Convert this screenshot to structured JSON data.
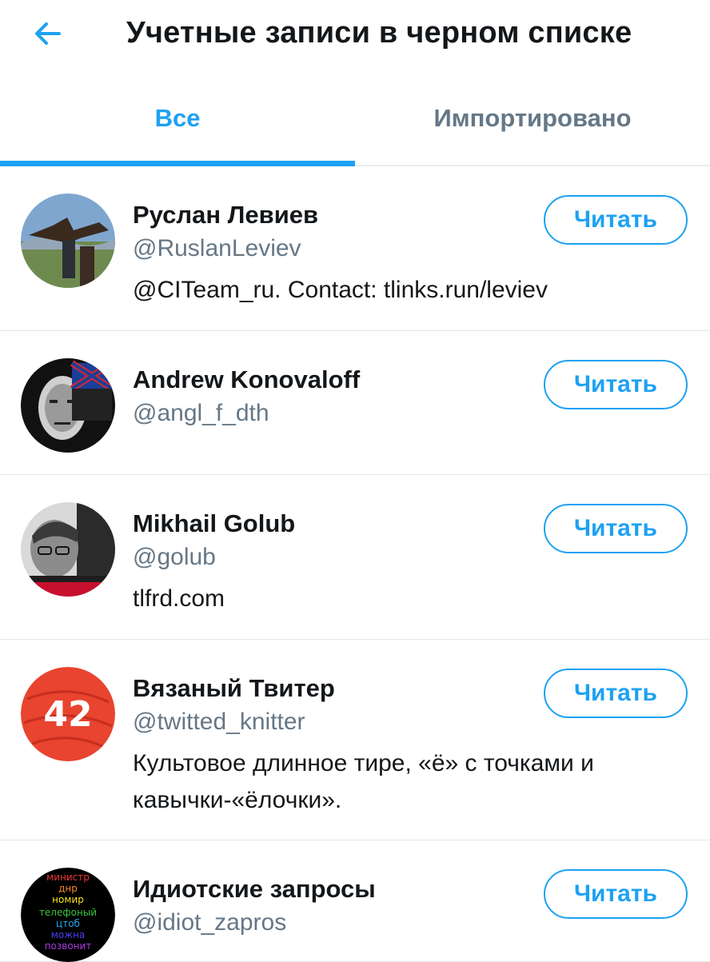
{
  "header": {
    "title": "Учетные записи в черном списке"
  },
  "tabs": [
    {
      "label": "Все",
      "active": true
    },
    {
      "label": "Импортировано",
      "active": false
    }
  ],
  "accounts": [
    {
      "name": "Руслан Левиев",
      "handle": "@RuslanLeviev",
      "bio": "@CITeam_ru. Contact: tlinks.run/leviev",
      "button": "Читать"
    },
    {
      "name": "Andrew Konovaloff",
      "handle": "@angl_f_dth",
      "bio": "",
      "button": "Читать"
    },
    {
      "name": "Mikhail Golub",
      "handle": "@golub",
      "bio": "tlfrd.com",
      "button": "Читать"
    },
    {
      "name": "Вязаный Твитер",
      "handle": "@twitted_knitter",
      "bio": "Культовое длинное тире, «ё» с точками и кавычки-«ёлочки».",
      "button": "Читать",
      "avatar_text": "42"
    },
    {
      "name": "Идиотские запросы",
      "handle": "@idiot_zapros",
      "bio": "",
      "button": "Читать",
      "avatar_text_lines": [
        "министр",
        "днр",
        "номир",
        "телефоный",
        "цтоб",
        "можна",
        "позвонит"
      ]
    }
  ],
  "colors": {
    "accent": "#1da1f2",
    "secondary_text": "#657786",
    "divider": "#e1e8ed"
  }
}
